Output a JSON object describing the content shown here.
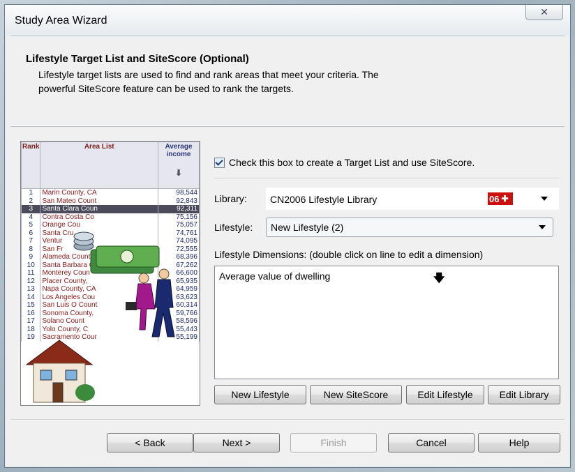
{
  "window": {
    "title": "Study Area Wizard",
    "close_glyph": "✕"
  },
  "header": {
    "title": "Lifestyle Target List and SiteScore (Optional)",
    "desc_line1": "Lifestyle target lists are used to find and rank areas that meet your criteria.  The",
    "desc_line2": "powerful SiteScore feature can be used to rank the targets."
  },
  "graphic": {
    "col_rank": "Rank",
    "col_area": "Area List",
    "col_avg": "Average income",
    "sort_glyph": "⬇",
    "rows": [
      [
        "1",
        "Marin County, CA",
        "98,544"
      ],
      [
        "2",
        "San Mateo Count",
        "92,843"
      ],
      [
        "3",
        "Santa Clara Coun",
        "92,311"
      ],
      [
        "4",
        "Contra Costa Co",
        "75,156"
      ],
      [
        "5",
        "Orange Cou",
        "75,057"
      ],
      [
        "6",
        "Santa Cru",
        "74,761"
      ],
      [
        "7",
        "Ventur",
        "74,095"
      ],
      [
        "8",
        "San Fr",
        "72,555"
      ],
      [
        "9",
        "Alameda County,",
        "68,396"
      ],
      [
        "10",
        "Santa Barbara Co",
        "67,262"
      ],
      [
        "11",
        "Monterey Coun",
        "66,600"
      ],
      [
        "12",
        "Placer County,",
        "65,935"
      ],
      [
        "13",
        "Napa County, CA",
        "64,959"
      ],
      [
        "14",
        "Los Angeles Cou",
        "63,623"
      ],
      [
        "15",
        "San Luis O Count",
        "60,314"
      ],
      [
        "16",
        "Sonoma County,",
        "59,766"
      ],
      [
        "17",
        "Solano Count",
        "58,596"
      ],
      [
        "18",
        "Yolo County, C",
        "55,443"
      ],
      [
        "19",
        "Sacramento Cour",
        "55,199"
      ]
    ],
    "selected_index": 2
  },
  "options": {
    "checkbox_label": "Check this box to create a Target List and use SiteScore.",
    "checkbox_checked": true,
    "library_label": "Library:",
    "library_value": "CN2006 Lifestyle Library",
    "library_flag": "06",
    "library_flag_icon": "maple-leaf-icon",
    "lifestyle_label": "Lifestyle:",
    "lifestyle_value": "New Lifestyle (2)",
    "dimensions_label": "Lifestyle Dimensions: (double click on line to edit a dimension)",
    "dimension_item": "Average value of dwelling",
    "dimension_glyph": "🡇"
  },
  "action_buttons": {
    "new_lifestyle": "New Lifestyle",
    "new_sitescore": "New SiteScore",
    "edit_lifestyle": "Edit Lifestyle",
    "edit_library": "Edit Library"
  },
  "nav_buttons": {
    "back": "< Back",
    "next": "Next >",
    "finish": "Finish",
    "cancel": "Cancel",
    "help": "Help"
  },
  "colors": {
    "flag_red": "#cc1010",
    "row_selected": "#4a4a5a"
  }
}
